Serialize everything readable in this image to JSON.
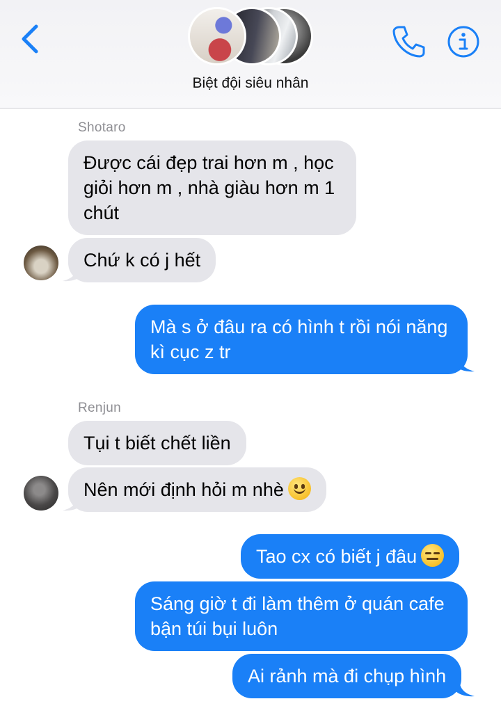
{
  "header": {
    "group_name": "Biệt đội siêu nhân",
    "back_icon": "chevron-left-icon",
    "call_icon": "phone-icon",
    "info_icon": "info-icon",
    "accent_color": "#1a80f7"
  },
  "messages": [
    {
      "sender": "Shotaro"
    },
    {
      "text": "Được cái đẹp trai hơn m , học giỏi hơn m , nhà giàu hơn m 1 chút"
    },
    {
      "text": "Chứ k có j hết"
    },
    {
      "text": "Mà s ở đâu ra có hình t rồi nói năng kì cục z tr"
    },
    {
      "sender": "Renjun"
    },
    {
      "text": "Tụi t biết chết liền"
    },
    {
      "text": "Nên mới định hỏi m nhè",
      "emoji": "slightly-smiling-face"
    },
    {
      "text": "Tao cx có biết j đâu",
      "emoji": "expressionless-face"
    },
    {
      "text": "Sáng giờ t đi làm thêm ở quán cafe bận túi bụi luôn"
    },
    {
      "text": "Ai rảnh mà đi chụp hình"
    }
  ]
}
